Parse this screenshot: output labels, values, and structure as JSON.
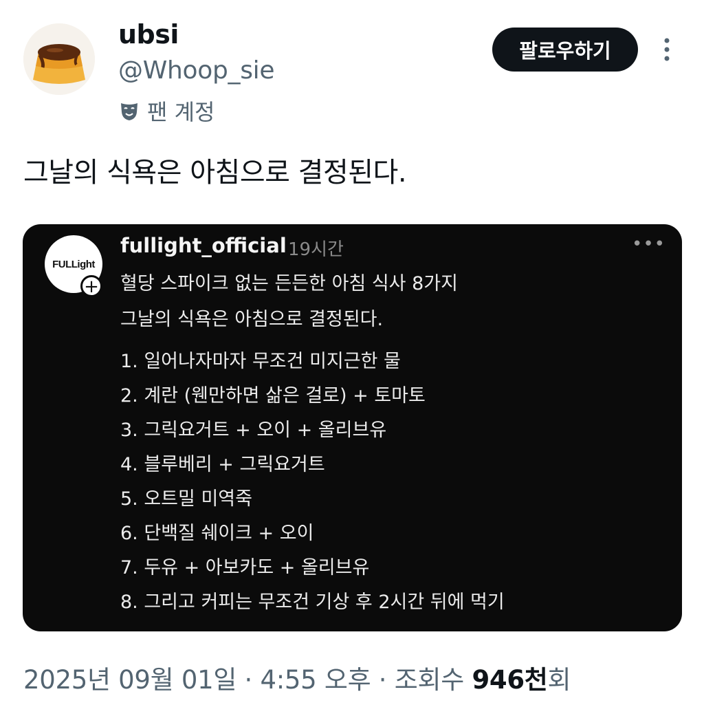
{
  "author": {
    "display_name": "ubsi",
    "handle": "@Whoop_sie",
    "badge_label": "팬 계정",
    "badge_icon": "theater-mask-icon",
    "avatar": "pudding-avatar"
  },
  "actions": {
    "follow_label": "팔로우하기",
    "more_icon": "vertical-ellipsis-icon"
  },
  "tweet": {
    "text": "그날의 식욕은 아침으로 결정된다."
  },
  "media": {
    "username": "fullight_official",
    "time": "19시간",
    "avatar_text": "FULLight",
    "title": "혈당 스파이크 없는 든든한  아침 식사 8가지",
    "subtitle": "그날의 식욕은 아침으로 결정된다.",
    "items": [
      "1. 일어나자마자 무조건 미지근한 물",
      "2. 계란 (웬만하면 삶은 걸로) + 토마토",
      "3. 그릭요거트 + 오이 + 올리브유",
      "4. 블루베리 + 그릭요거트",
      "5. 오트밀 미역죽",
      "6. 단백질 쉐이크 + 오이",
      "7. 두유 + 아보카도 + 올리브유",
      "8. 그리고 커피는 무조건 기상 후 2시간 뒤에 먹기"
    ]
  },
  "meta": {
    "date": "2025년 09월 01일",
    "time": "4:55 오후",
    "views_prefix": "조회수",
    "views_count": "946천",
    "views_suffix": "회",
    "separator": "·"
  },
  "colors": {
    "text_primary": "#0f1419",
    "text_secondary": "#536471",
    "media_bg": "#0b0b0b"
  }
}
